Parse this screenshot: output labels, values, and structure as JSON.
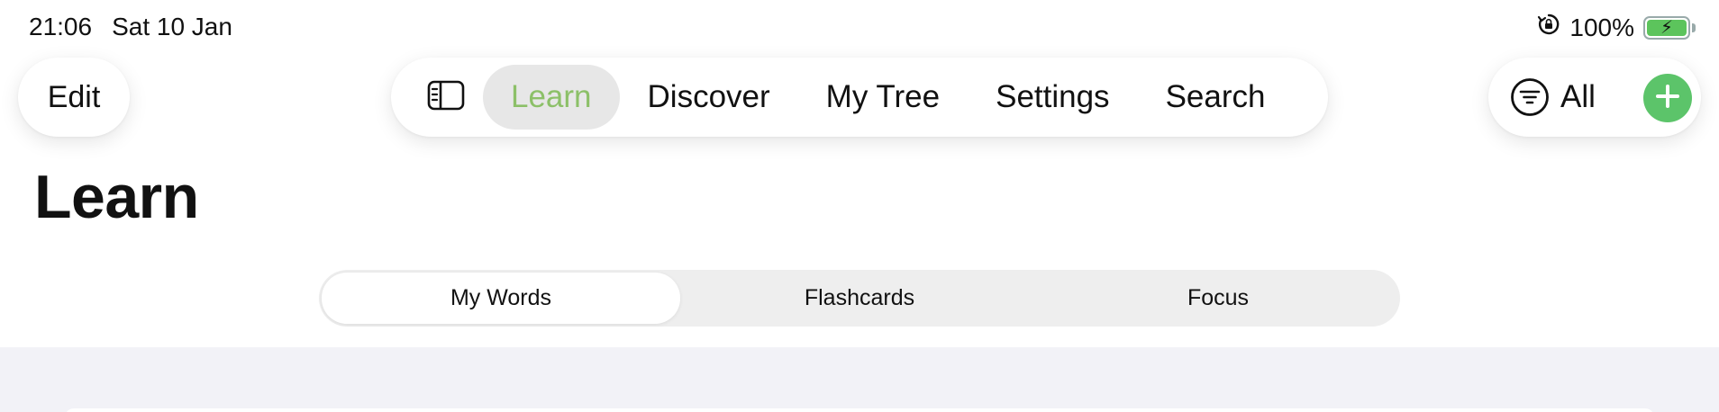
{
  "status_bar": {
    "time": "21:06",
    "date": "Sat 10 Jan",
    "battery_percent": "100%",
    "battery_level": 1.0,
    "charging": true,
    "icons": [
      "orientation-lock-icon",
      "battery-charging-icon"
    ]
  },
  "toolbar": {
    "edit_label": "Edit",
    "sidebar_icon": "sidebar-icon",
    "tabs": [
      {
        "label": "Learn",
        "active": true
      },
      {
        "label": "Discover",
        "active": false
      },
      {
        "label": "My Tree",
        "active": false
      },
      {
        "label": "Settings",
        "active": false
      },
      {
        "label": "Search",
        "active": false
      }
    ],
    "filter_icon": "filter-icon",
    "filter_label": "All",
    "add_icon": "plus-icon"
  },
  "page": {
    "title": "Learn"
  },
  "segmented": {
    "options": [
      "My Words",
      "Flashcards",
      "Focus"
    ],
    "selected": "My Words"
  },
  "colors": {
    "accent_green": "#8cc068",
    "add_button_green": "#5cc46a",
    "background_grey": "#f2f2f7",
    "segment_bg": "#eeeeee"
  }
}
